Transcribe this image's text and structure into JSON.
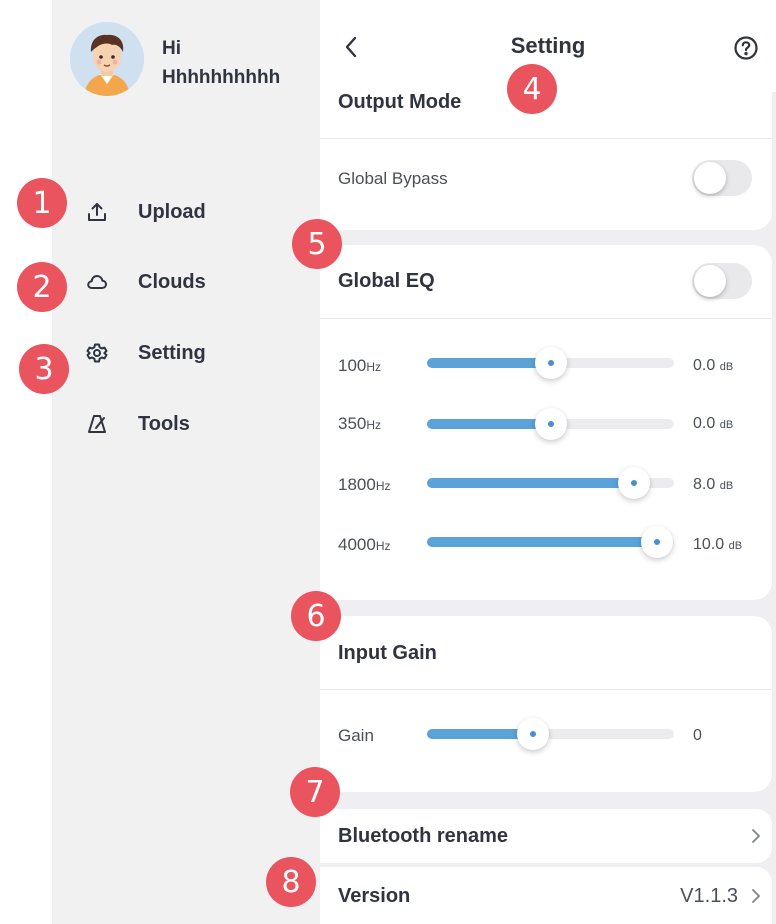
{
  "profile": {
    "greeting": "Hi",
    "username": "Hhhhhhhhhh",
    "avatar_icon": "avatar-boy-icon"
  },
  "nav": [
    {
      "label": "Upload",
      "icon": "upload-icon"
    },
    {
      "label": "Clouds",
      "icon": "cloud-icon"
    },
    {
      "label": "Setting",
      "icon": "gear-icon"
    },
    {
      "label": "Tools",
      "icon": "metronome-icon"
    }
  ],
  "markers": [
    "1",
    "2",
    "3",
    "4",
    "5",
    "6",
    "7",
    "8"
  ],
  "header": {
    "title": "Setting",
    "back_icon": "chevron-left-icon",
    "help_icon": "help-circle-icon"
  },
  "output_mode": {
    "title": "Output Mode",
    "global_bypass_label": "Global Bypass",
    "global_bypass_on": false
  },
  "global_eq": {
    "title": "Global EQ",
    "enabled": false,
    "bands": [
      {
        "freq": "100",
        "freq_unit": "Hz",
        "value": "0.0",
        "value_unit": "dB",
        "level": 0.5
      },
      {
        "freq": "350",
        "freq_unit": "Hz",
        "value": "0.0",
        "value_unit": "dB",
        "level": 0.5
      },
      {
        "freq": "1800",
        "freq_unit": "Hz",
        "value": "8.0",
        "value_unit": "dB",
        "level": 0.84
      },
      {
        "freq": "4000",
        "freq_unit": "Hz",
        "value": "10.0",
        "value_unit": "dB",
        "level": 0.93
      }
    ]
  },
  "input_gain": {
    "title": "Input Gain",
    "label": "Gain",
    "value": "0",
    "level": 0.43
  },
  "bluetooth": {
    "label": "Bluetooth rename"
  },
  "version": {
    "label": "Version",
    "value": "V1.1.3"
  },
  "colors": {
    "accent": "#5ba2d9",
    "marker": "#e9545e",
    "sidebar_bg": "#f1f1f2"
  }
}
